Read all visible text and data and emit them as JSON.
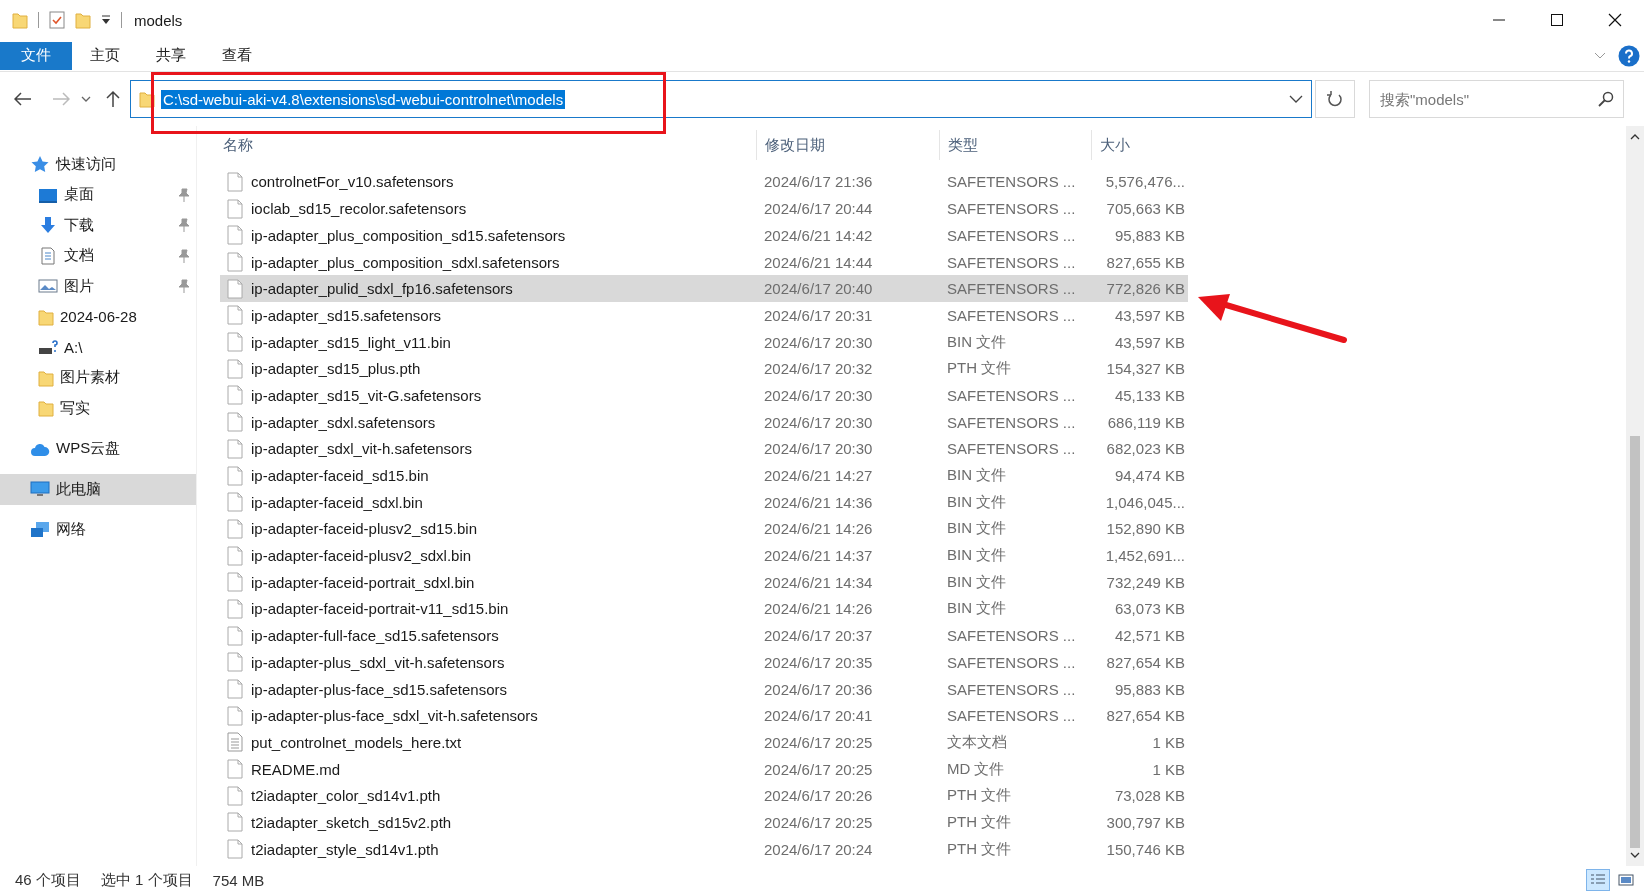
{
  "window": {
    "title": "models"
  },
  "ribbon": {
    "file_menu": "文件",
    "tabs": [
      "主页",
      "共享",
      "查看"
    ]
  },
  "address": {
    "path": "C:\\sd-webui-aki-v4.8\\extensions\\sd-webui-controlnet\\models",
    "selected": true
  },
  "search": {
    "placeholder": "搜索\"models\""
  },
  "sidebar": [
    {
      "label": "快速访问",
      "kind": "star",
      "selected": false,
      "children": [
        {
          "label": "桌面",
          "kind": "desktop",
          "selected": false,
          "pinned": true
        },
        {
          "label": "下载",
          "kind": "download",
          "selected": false,
          "pinned": true
        },
        {
          "label": "文档",
          "kind": "document",
          "selected": false,
          "pinned": true
        },
        {
          "label": "图片",
          "kind": "pictures",
          "selected": false,
          "pinned": true
        },
        {
          "label": "2024-06-28",
          "kind": "folder",
          "selected": false,
          "pinned": false
        },
        {
          "label": "A:\\",
          "kind": "drive",
          "selected": false,
          "pinned": false
        },
        {
          "label": "图片素材",
          "kind": "folder",
          "selected": false,
          "pinned": false
        },
        {
          "label": "写实",
          "kind": "folder",
          "selected": false,
          "pinned": false
        }
      ]
    },
    {
      "label": "WPS云盘",
      "kind": "cloud",
      "selected": false
    },
    {
      "label": "此电脑",
      "kind": "pc",
      "selected": true
    },
    {
      "label": "网络",
      "kind": "network",
      "selected": false
    }
  ],
  "columns": [
    "名称",
    "修改日期",
    "类型",
    "大小"
  ],
  "rows": [
    {
      "name": "controlnetFor_v10.safetensors",
      "date": "2024/6/17 21:36",
      "type": "SAFETENSORS ...",
      "size": "5,576,476...",
      "kind": "file",
      "selected": false
    },
    {
      "name": "ioclab_sd15_recolor.safetensors",
      "date": "2024/6/17 20:44",
      "type": "SAFETENSORS ...",
      "size": "705,663 KB",
      "kind": "file",
      "selected": false
    },
    {
      "name": "ip-adapter_plus_composition_sd15.safetensors",
      "date": "2024/6/21 14:42",
      "type": "SAFETENSORS ...",
      "size": "95,883 KB",
      "kind": "file",
      "selected": false
    },
    {
      "name": "ip-adapter_plus_composition_sdxl.safetensors",
      "date": "2024/6/21 14:44",
      "type": "SAFETENSORS ...",
      "size": "827,655 KB",
      "kind": "file",
      "selected": false
    },
    {
      "name": "ip-adapter_pulid_sdxl_fp16.safetensors",
      "date": "2024/6/17 20:40",
      "type": "SAFETENSORS ...",
      "size": "772,826 KB",
      "kind": "file",
      "selected": true
    },
    {
      "name": "ip-adapter_sd15.safetensors",
      "date": "2024/6/17 20:31",
      "type": "SAFETENSORS ...",
      "size": "43,597 KB",
      "kind": "file",
      "selected": false
    },
    {
      "name": "ip-adapter_sd15_light_v11.bin",
      "date": "2024/6/17 20:30",
      "type": "BIN 文件",
      "size": "43,597 KB",
      "kind": "file",
      "selected": false
    },
    {
      "name": "ip-adapter_sd15_plus.pth",
      "date": "2024/6/17 20:32",
      "type": "PTH 文件",
      "size": "154,327 KB",
      "kind": "file",
      "selected": false
    },
    {
      "name": "ip-adapter_sd15_vit-G.safetensors",
      "date": "2024/6/17 20:30",
      "type": "SAFETENSORS ...",
      "size": "45,133 KB",
      "kind": "file",
      "selected": false
    },
    {
      "name": "ip-adapter_sdxl.safetensors",
      "date": "2024/6/17 20:30",
      "type": "SAFETENSORS ...",
      "size": "686,119 KB",
      "kind": "file",
      "selected": false
    },
    {
      "name": "ip-adapter_sdxl_vit-h.safetensors",
      "date": "2024/6/17 20:30",
      "type": "SAFETENSORS ...",
      "size": "682,023 KB",
      "kind": "file",
      "selected": false
    },
    {
      "name": "ip-adapter-faceid_sd15.bin",
      "date": "2024/6/21 14:27",
      "type": "BIN 文件",
      "size": "94,474 KB",
      "kind": "file",
      "selected": false
    },
    {
      "name": "ip-adapter-faceid_sdxl.bin",
      "date": "2024/6/21 14:36",
      "type": "BIN 文件",
      "size": "1,046,045...",
      "kind": "file",
      "selected": false
    },
    {
      "name": "ip-adapter-faceid-plusv2_sd15.bin",
      "date": "2024/6/21 14:26",
      "type": "BIN 文件",
      "size": "152,890 KB",
      "kind": "file",
      "selected": false
    },
    {
      "name": "ip-adapter-faceid-plusv2_sdxl.bin",
      "date": "2024/6/21 14:37",
      "type": "BIN 文件",
      "size": "1,452,691...",
      "kind": "file",
      "selected": false
    },
    {
      "name": "ip-adapter-faceid-portrait_sdxl.bin",
      "date": "2024/6/21 14:34",
      "type": "BIN 文件",
      "size": "732,249 KB",
      "kind": "file",
      "selected": false
    },
    {
      "name": "ip-adapter-faceid-portrait-v11_sd15.bin",
      "date": "2024/6/21 14:26",
      "type": "BIN 文件",
      "size": "63,073 KB",
      "kind": "file",
      "selected": false
    },
    {
      "name": "ip-adapter-full-face_sd15.safetensors",
      "date": "2024/6/17 20:37",
      "type": "SAFETENSORS ...",
      "size": "42,571 KB",
      "kind": "file",
      "selected": false
    },
    {
      "name": "ip-adapter-plus_sdxl_vit-h.safetensors",
      "date": "2024/6/17 20:35",
      "type": "SAFETENSORS ...",
      "size": "827,654 KB",
      "kind": "file",
      "selected": false
    },
    {
      "name": "ip-adapter-plus-face_sd15.safetensors",
      "date": "2024/6/17 20:36",
      "type": "SAFETENSORS ...",
      "size": "95,883 KB",
      "kind": "file",
      "selected": false
    },
    {
      "name": "ip-adapter-plus-face_sdxl_vit-h.safetensors",
      "date": "2024/6/17 20:41",
      "type": "SAFETENSORS ...",
      "size": "827,654 KB",
      "kind": "file",
      "selected": false
    },
    {
      "name": "put_controlnet_models_here.txt",
      "date": "2024/6/17 20:25",
      "type": "文本文档",
      "size": "1 KB",
      "kind": "text",
      "selected": false
    },
    {
      "name": "README.md",
      "date": "2024/6/17 20:25",
      "type": "MD 文件",
      "size": "1 KB",
      "kind": "file",
      "selected": false
    },
    {
      "name": "t2iadapter_color_sd14v1.pth",
      "date": "2024/6/17 20:26",
      "type": "PTH 文件",
      "size": "73,028 KB",
      "kind": "file",
      "selected": false
    },
    {
      "name": "t2iadapter_sketch_sd15v2.pth",
      "date": "2024/6/17 20:25",
      "type": "PTH 文件",
      "size": "300,797 KB",
      "kind": "file",
      "selected": false
    },
    {
      "name": "t2iadapter_style_sd14v1.pth",
      "date": "2024/6/17 20:24",
      "type": "PTH 文件",
      "size": "150,746 KB",
      "kind": "file",
      "selected": false
    }
  ],
  "status_bar": {
    "count": "46 个项目",
    "selection": "选中 1 个项目",
    "size": "754 MB"
  },
  "views": [
    {
      "kind": "details",
      "selected": true
    },
    {
      "kind": "large-icons",
      "selected": false
    }
  ]
}
